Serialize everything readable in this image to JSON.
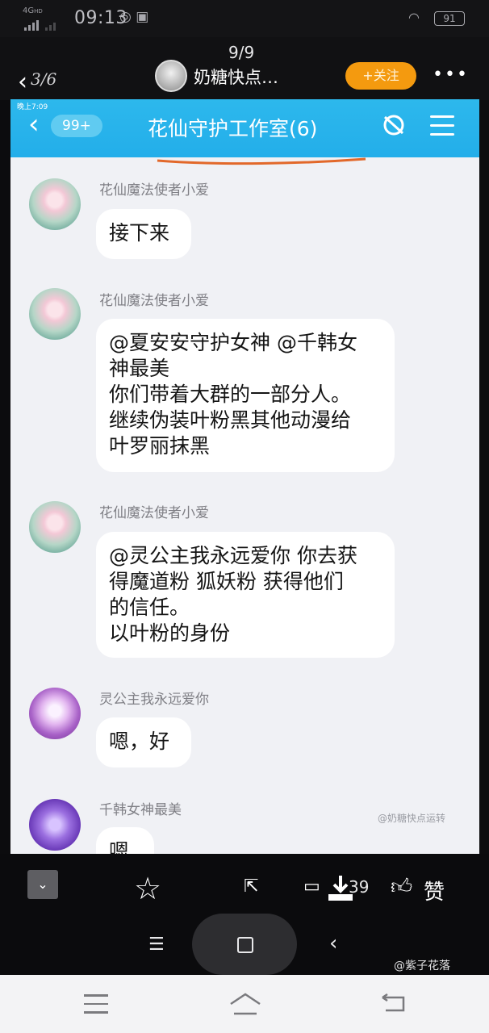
{
  "status_bar": {
    "network": "4G",
    "hd": "HD",
    "time": "09:13",
    "battery": "91"
  },
  "viewer": {
    "counter": "9/9",
    "index_label": "3/6",
    "author_name": "奶糖快点…",
    "follow_label": "+关注",
    "more_label": "•••"
  },
  "chat": {
    "status_time": "晚上7:09",
    "unread_badge": "99+",
    "title": "花仙守护工作室(6)",
    "messages": [
      {
        "sender": "花仙魔法使者小爱",
        "text": "接下来"
      },
      {
        "sender": "花仙魔法使者小爱",
        "text": "@夏安安守护女神 @千韩女\n神最美\n你们带着大群的一部分人。\n继续伪装叶粉黑其他动漫给\n叶罗丽抹黑"
      },
      {
        "sender": "花仙魔法使者小爱",
        "text": "@灵公主我永远爱你 你去获\n得魔道粉 狐妖粉 获得他们\n的信任。\n 以叶粉的身份"
      },
      {
        "sender": "灵公主我永远爱你",
        "text": "嗯，好"
      },
      {
        "sender": "千韩女神最美",
        "text": "嗯"
      }
    ],
    "watermark": "@奶糖快点运转"
  },
  "toolbar": {
    "comment_count": "39",
    "like_label": "赞"
  },
  "nav": {
    "watermark": "@紫子花落"
  },
  "colors": {
    "header_blue": "#23aeea",
    "follow_orange": "#f49a0f",
    "underline_orange": "#e2682a"
  }
}
